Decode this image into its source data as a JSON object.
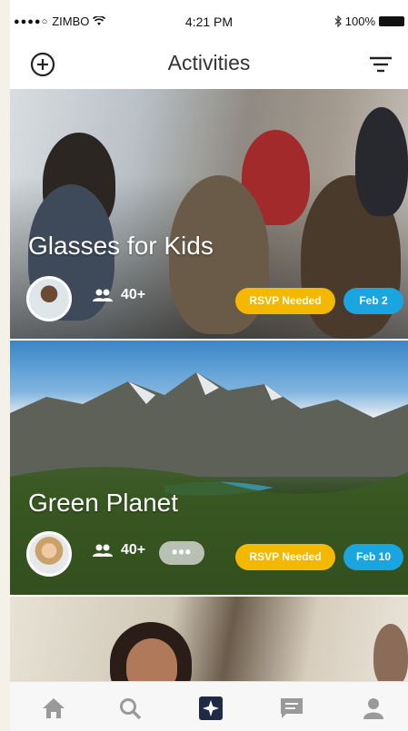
{
  "status_bar": {
    "signal": "●●●●○",
    "carrier": "ZIMBO",
    "time": "4:21 PM",
    "battery": "100%"
  },
  "header": {
    "title": "Activities",
    "add_icon": "add-circle-icon",
    "filter_icon": "filter-icon"
  },
  "activities": [
    {
      "title": "Glasses for Kids",
      "attendees": "40+",
      "rsvp": "RSVP Needed",
      "date": "Feb 2"
    },
    {
      "title": "Green Planet",
      "attendees": "40+",
      "more": "•••",
      "rsvp": "RSVP Needed",
      "date": "Feb 10"
    }
  ],
  "tabbar": {
    "items": [
      {
        "icon": "home-icon",
        "active": false
      },
      {
        "icon": "search-icon",
        "active": false
      },
      {
        "icon": "activities-star-icon",
        "active": true
      },
      {
        "icon": "chat-icon",
        "active": false
      },
      {
        "icon": "profile-icon",
        "active": false
      }
    ]
  },
  "colors": {
    "rsvp": "#f5b800",
    "date": "#1ba5e0",
    "active_tab": "#1f2a44",
    "inactive_tab": "#9a9a9a"
  }
}
